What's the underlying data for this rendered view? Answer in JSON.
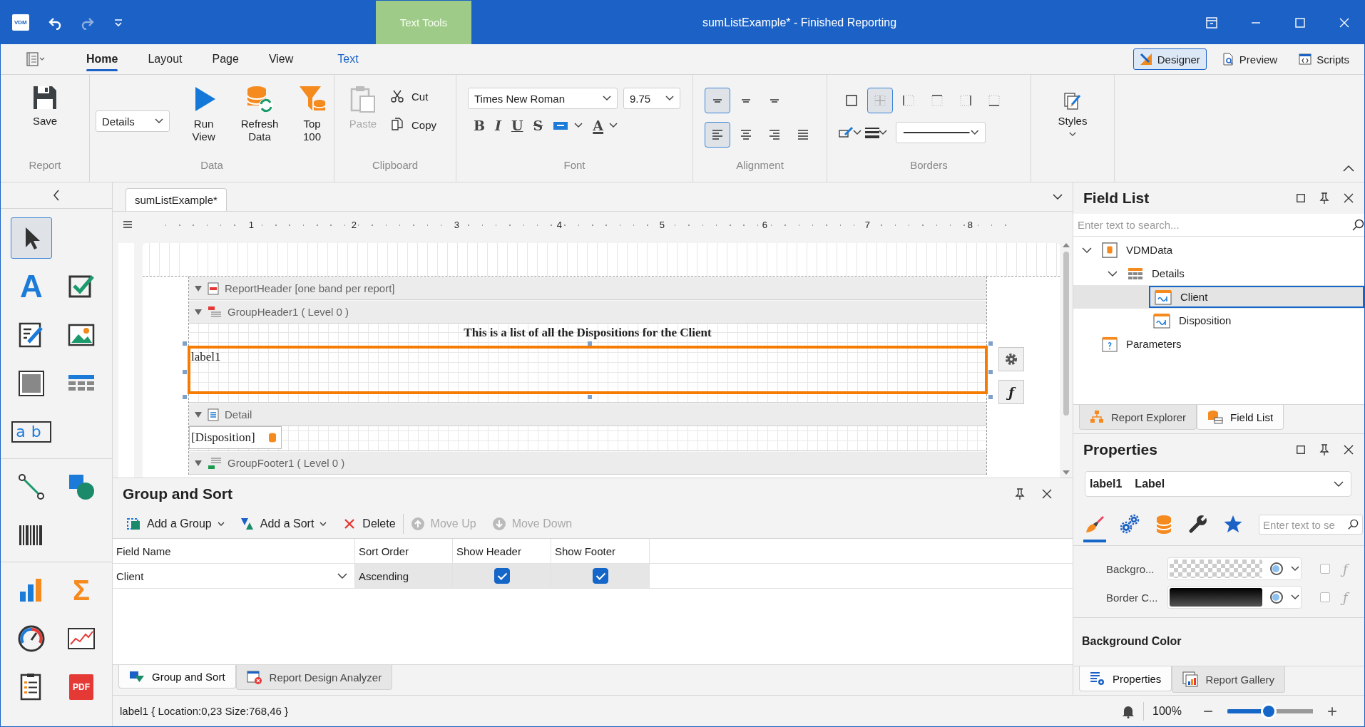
{
  "window": {
    "app_logo": "VDM",
    "context_tab": "Text Tools",
    "title": "sumListExample* - Finished Reporting"
  },
  "ribbon_tabs": [
    {
      "label": "Home",
      "selected": true,
      "kind": "normal"
    },
    {
      "label": "Layout",
      "selected": false,
      "kind": "normal"
    },
    {
      "label": "Page",
      "selected": false,
      "kind": "normal"
    },
    {
      "label": "View",
      "selected": false,
      "kind": "normal"
    },
    {
      "label": "Text",
      "selected": false,
      "kind": "contextual"
    }
  ],
  "view_modes": [
    {
      "label": "Designer",
      "selected": true,
      "kind": "designer"
    },
    {
      "label": "Preview",
      "selected": false,
      "kind": "preview"
    },
    {
      "label": "Scripts",
      "selected": false,
      "kind": "scripts"
    }
  ],
  "ribbon": {
    "report": {
      "caption": "Report",
      "save": "Save"
    },
    "data": {
      "caption": "Data",
      "view_select": "Details",
      "buttons": [
        {
          "label": "Run View",
          "kind": "run"
        },
        {
          "label": "Refresh Data",
          "kind": "refresh"
        },
        {
          "label": "Top 100",
          "kind": "top"
        }
      ]
    },
    "clipboard": {
      "caption": "Clipboard",
      "paste": {
        "label": "Paste",
        "disabled": true
      },
      "cut": "Cut",
      "copy": "Copy"
    },
    "font": {
      "caption": "Font",
      "family": "Times New Roman",
      "size": "9.75",
      "styles": [
        {
          "glyph": "B",
          "kind": "bold"
        },
        {
          "glyph": "I",
          "kind": "italic"
        },
        {
          "glyph": "U",
          "kind": "underline"
        },
        {
          "glyph": "S",
          "kind": "strike"
        }
      ],
      "color_glyph": "A"
    },
    "alignment": {
      "caption": "Alignment",
      "vertical": [
        {
          "selected": true
        },
        {
          "selected": false
        },
        {
          "selected": false
        }
      ],
      "horizontal": [
        {
          "selected": true
        },
        {
          "selected": false
        },
        {
          "selected": false
        },
        {
          "selected": false
        }
      ]
    },
    "borders": {
      "caption": "Borders",
      "sides": [
        {
          "selected": false
        },
        {
          "selected": true
        },
        {
          "selected": false
        },
        {
          "selected": false
        },
        {
          "selected": false
        },
        {
          "selected": false
        }
      ]
    },
    "styles": {
      "label": "Styles"
    }
  },
  "toolbox": [
    [
      {
        "kind": "pointer",
        "selected": true
      }
    ],
    [
      {
        "kind": "label",
        "glyph": "A",
        "selected": false
      },
      {
        "kind": "checkbox",
        "selected": false
      },
      {
        "kind": "richtext",
        "selected": false
      },
      {
        "kind": "picture",
        "selected": false
      },
      {
        "kind": "panel",
        "selected": false
      },
      {
        "kind": "table",
        "selected": false
      },
      {
        "kind": "charcomb",
        "glyph": "ab",
        "selected": false
      }
    ],
    [
      {
        "kind": "line",
        "selected": false
      },
      {
        "kind": "shape",
        "selected": false
      },
      {
        "kind": "barcode",
        "selected": false
      }
    ],
    [
      {
        "kind": "chart",
        "selected": false
      },
      {
        "kind": "summary",
        "glyph": "Σ",
        "selected": false
      },
      {
        "kind": "gauge",
        "selected": false
      },
      {
        "kind": "sparkline",
        "selected": false
      },
      {
        "kind": "toc",
        "selected": false
      },
      {
        "kind": "pdf",
        "glyph": "PDF",
        "selected": false
      }
    ]
  ],
  "document_tab": "sumListExample*",
  "ruler": [
    "1",
    "2",
    "3",
    "4",
    "5",
    "6",
    "7",
    "8"
  ],
  "bands": [
    {
      "kind": "report_header",
      "label": "ReportHeader [one band per report]"
    },
    {
      "kind": "group_header",
      "label": "GroupHeader1 ( Level 0 )"
    },
    {
      "kind": "group_content",
      "title": "This is a list of all the Dispositions for the Client",
      "label": {
        "text": "label1",
        "selected": true
      }
    },
    {
      "kind": "detail",
      "label": "Detail"
    },
    {
      "kind": "detail_content",
      "field": "[Disposition]"
    },
    {
      "kind": "group_footer",
      "label": "GroupFooter1 ( Level 0 )"
    }
  ],
  "side_buttons": [
    {
      "kind": "settings"
    },
    {
      "kind": "function",
      "glyph": "ƒ"
    }
  ],
  "group_sort": {
    "title": "Group and Sort",
    "toolbar": [
      {
        "label": "Add a Group",
        "kind": "add_group",
        "disabled": false
      },
      {
        "label": "Add a Sort",
        "kind": "add_sort",
        "disabled": false
      },
      {
        "label": "Delete",
        "kind": "delete",
        "disabled": false
      },
      {
        "label": "Move Up",
        "kind": "up",
        "disabled": true
      },
      {
        "label": "Move Down",
        "kind": "down",
        "disabled": true
      }
    ],
    "columns": [
      "Field Name",
      "Sort Order",
      "Show Header",
      "Show Footer"
    ],
    "rows": [
      {
        "field": "Client",
        "sort_order": "Ascending",
        "show_header": true,
        "show_footer": true
      }
    ]
  },
  "bottom_tabs": [
    {
      "label": "Group and Sort",
      "kind": "group_sort",
      "selected": true
    },
    {
      "label": "Report Design Analyzer",
      "kind": "analyzer",
      "selected": false
    }
  ],
  "field_list": {
    "title": "Field List",
    "search_placeholder": "Enter text to search...",
    "tree": [
      {
        "label": "VDMData",
        "kind": "source",
        "selected": false,
        "expanded": true,
        "children": [
          {
            "label": "Details",
            "kind": "table",
            "selected": false,
            "expanded": true,
            "children": [
              {
                "label": "Client",
                "kind": "field",
                "selected": true
              },
              {
                "label": "Disposition",
                "kind": "field",
                "selected": false
              }
            ]
          }
        ]
      },
      {
        "label": "Parameters",
        "kind": "parameters",
        "selected": false
      }
    ]
  },
  "explorer_tabs": [
    {
      "label": "Report Explorer",
      "kind": "explorer",
      "selected": false
    },
    {
      "label": "Field List",
      "kind": "fields",
      "selected": true
    }
  ],
  "properties": {
    "title": "Properties",
    "object_name": "label1",
    "object_type": "Label",
    "tabs": [
      {
        "kind": "appearance",
        "selected": true
      },
      {
        "kind": "behavior",
        "selected": false
      },
      {
        "kind": "data",
        "selected": false
      },
      {
        "kind": "layout",
        "selected": false
      },
      {
        "kind": "favorites",
        "selected": false
      }
    ],
    "search_placeholder": "Enter text to se",
    "rows": [
      {
        "label": "Backgro...",
        "kind": "transparent",
        "checked": false,
        "glyph": "ƒ"
      },
      {
        "label": "Border C...",
        "kind": "black",
        "checked": false,
        "glyph": "ƒ"
      }
    ],
    "description_title": "Background Color"
  },
  "property_tabs": [
    {
      "label": "Properties",
      "kind": "properties",
      "selected": true
    },
    {
      "label": "Report Gallery",
      "kind": "gallery",
      "selected": false
    }
  ],
  "status_bar": {
    "text": "label1 { Location:0,23 Size:768,46 }",
    "zoom": "100%",
    "minus": "−",
    "plus": "+",
    "zoom_slider": {
      "level": 0.48
    }
  }
}
